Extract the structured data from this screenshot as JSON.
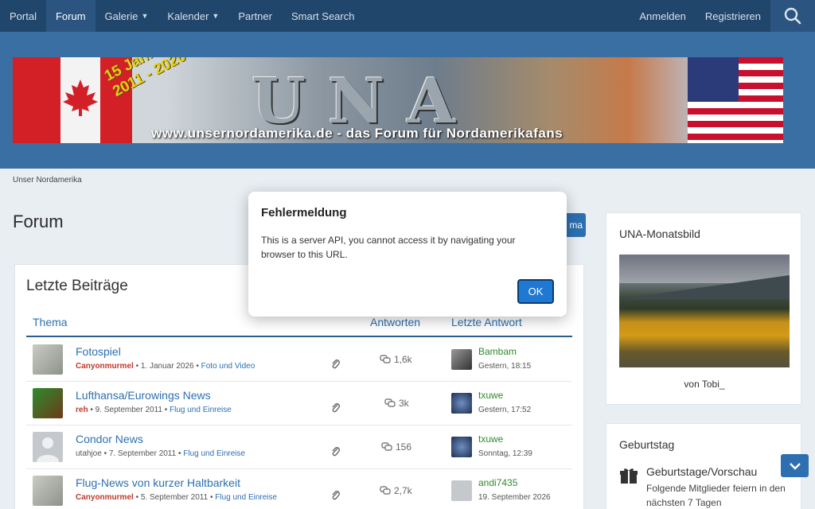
{
  "nav": {
    "items": [
      {
        "label": "Portal",
        "active": false,
        "dropdown": false
      },
      {
        "label": "Forum",
        "active": true,
        "dropdown": false
      },
      {
        "label": "Galerie",
        "active": false,
        "dropdown": true
      },
      {
        "label": "Kalender",
        "active": false,
        "dropdown": true
      },
      {
        "label": "Partner",
        "active": false,
        "dropdown": false
      },
      {
        "label": "Smart Search",
        "active": false,
        "dropdown": false
      }
    ],
    "login": "Anmelden",
    "register": "Registrieren",
    "search_icon": "search-icon"
  },
  "banner": {
    "logo_text": "UNA",
    "jubilee_line1": "15 Jahre",
    "jubilee_line2": "2011 - 2026",
    "url_text": "www.unsernordamerika.de - das Forum für Nordamerikafans"
  },
  "breadcrumb": "Unser Nordamerika",
  "page_title": "Forum",
  "new_topic_label": "ma",
  "latest_posts": {
    "title": "Letzte Beiträge",
    "columns": {
      "topic": "Thema",
      "replies": "Antworten",
      "last_reply": "Letzte Antwort"
    },
    "rows": [
      {
        "title": "Fotospiel",
        "author": "Canyonmurmel",
        "author_colored": true,
        "date": "1. Januar 2026",
        "board": "Foto und Video",
        "replies": "1,6k",
        "last_user": "Bambam",
        "last_date": "Gestern, 18:15"
      },
      {
        "title": "Lufthansa/Eurowings News",
        "author": "reh",
        "author_colored": true,
        "date": "9. September 2011",
        "board": "Flug und Einreise",
        "replies": "3k",
        "last_user": "txuwe",
        "last_date": "Gestern, 17:52"
      },
      {
        "title": "Condor News",
        "author": "utahjoe",
        "author_colored": false,
        "date": "7. September 2011",
        "board": "Flug und Einreise",
        "replies": "156",
        "last_user": "txuwe",
        "last_date": "Sonntag, 12:39"
      },
      {
        "title": "Flug-News von kurzer Haltbarkeit",
        "author": "Canyonmurmel",
        "author_colored": true,
        "date": "5. September 2011",
        "board": "Flug und Einreise",
        "replies": "2,7k",
        "last_user": "andi7435",
        "last_date": "19. September 2026"
      }
    ]
  },
  "sidebar": {
    "photo_block": {
      "title": "UNA-Monatsbild",
      "credit": "von Tobi_"
    },
    "birthday_block": {
      "title": "Geburtstag",
      "item_title": "Geburtstage/Vorschau",
      "item_desc": "Folgende Mitglieder feiern in den nächsten 7 Tagen"
    }
  },
  "modal": {
    "title": "Fehlermeldung",
    "message": "This is a server API, you cannot access it by navigating your browser to this URL.",
    "ok_label": "OK"
  },
  "colors": {
    "nav_bg": "#21466b",
    "header_bg": "#3a6fa3",
    "link": "#2d6fb0",
    "accent_button": "#1f78d1",
    "author_red": "#c0392b",
    "user_green": "#2f8a2f"
  }
}
